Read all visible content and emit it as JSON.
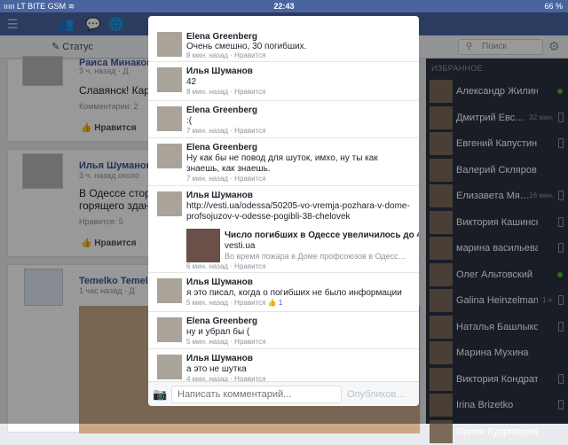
{
  "statusbar": {
    "carrier": "ııııı LT BITE GSM ≋",
    "time": "22:43",
    "battery": "66 %"
  },
  "toolbar": {
    "status_label": "Статус",
    "search_placeholder": "Поиск"
  },
  "feed": [
    {
      "name": "Раиса Минаков",
      "meta": "3 ч. назад · Д",
      "text": "Славянск! Кара",
      "comments": "Комментарии: 2",
      "like": "Нравится"
    },
    {
      "name": "Илья Шуманов",
      "meta": "3 ч. назад около",
      "text1": "В Одессе сторо",
      "text2": "горящего здани",
      "likes": "Нравится: 5",
      "like": "Нравится"
    },
    {
      "name": "Temelko Temelk",
      "meta": "1 час назад · Д"
    }
  ],
  "sidebar": {
    "header": "ИЗБРАННОЕ",
    "friends": [
      {
        "name": "Александр Жилин",
        "status": "online",
        "when": ""
      },
      {
        "name": "Дмитрий Евс…",
        "status": "mobile",
        "when": "32 мин."
      },
      {
        "name": "Евгений Капустин",
        "status": "mobile",
        "when": ""
      },
      {
        "name": "Валерий Скляров",
        "status": "none",
        "when": ""
      },
      {
        "name": "Елизавета Мя…",
        "status": "mobile",
        "when": "16 мин."
      },
      {
        "name": "Виктория Кашинская",
        "status": "mobile",
        "when": ""
      },
      {
        "name": "марина васильева",
        "status": "mobile",
        "when": ""
      },
      {
        "name": "Олег Альтовский",
        "status": "online",
        "when": ""
      },
      {
        "name": "Galina Heinzelmann",
        "status": "mobile",
        "when": "1 ч."
      },
      {
        "name": "Наталья Башлыкова",
        "status": "mobile",
        "when": ""
      },
      {
        "name": "Марина Мухина",
        "status": "none",
        "when": ""
      },
      {
        "name": "Виктория Кондрат…",
        "status": "mobile",
        "when": ""
      },
      {
        "name": "Irina Brizetko",
        "status": "mobile",
        "when": ""
      },
      {
        "name": "Ирина Кудрявцева",
        "status": "none",
        "when": ""
      }
    ]
  },
  "comments": [
    {
      "name": "Elena Greenberg",
      "text": "Очень смешно, 30 погибших.",
      "meta": "8 мин. назад · Нравится"
    },
    {
      "name": "Илья Шуманов",
      "text": "42",
      "meta": "8 мин. назад · Нравится"
    },
    {
      "name": "Elena Greenberg",
      "text": ":(",
      "meta": "7 мин. назад · Нравится"
    },
    {
      "name": "Elena Greenberg",
      "text": "Ну как бы не повод для шуток, имхо, ну ты как знаешь, как знаешь.",
      "meta": "7 мин. назад · Нравится"
    },
    {
      "name": "Илья Шуманов",
      "link": "http://vesti.ua/odessa/50205-vo-vremja-pozhara-v-dome-profsojuzov-v-odesse-pogibli-38-chelovek",
      "preview_title": "Число погибших в Одессе увеличилось до 4…",
      "preview_site": "vesti.ua",
      "preview_desc": "Во время пожара в Доме профсоюзов в Одесс…",
      "meta": "6 мин. назад · Нравится"
    },
    {
      "name": "Илья Шуманов",
      "text": "я это писал, когда о погибших не было информации",
      "meta": "5 мин. назад · Нравится",
      "likes": "1"
    },
    {
      "name": "Elena Greenberg",
      "text": "ну и убрал бы (",
      "meta": "5 мин. назад · Нравится"
    },
    {
      "name": "Илья Шуманов",
      "text": "а это не шутка",
      "meta": "4 мин. назад · Нравится"
    }
  ],
  "composer": {
    "placeholder": "Написать комментарий...",
    "publish_label": "Опубликов…"
  }
}
